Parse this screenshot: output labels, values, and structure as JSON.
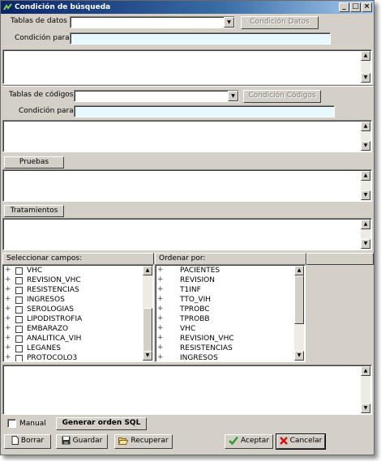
{
  "window": {
    "title": "Condición de búsqueda",
    "controls": [
      "_",
      "□",
      "×"
    ]
  },
  "datos": {
    "tables_label": "Tablas de datos",
    "condition_button": "Condición Datos",
    "condition_label": "Condición para",
    "condition_value": ""
  },
  "codigos": {
    "tables_label": "Tablas de códigos",
    "condition_button": "Condición Códigos",
    "condition_label": "Condición para",
    "condition_value": ""
  },
  "pruebas": {
    "header": "Pruebas"
  },
  "tratamientos": {
    "header": "Tratamientos"
  },
  "fields": {
    "select_header": "Seleccionar campos:",
    "order_header": "Ordenar por:",
    "select_items": [
      "VHC",
      "REVISION_VHC",
      "RESISTENCIAS",
      "INGRESOS",
      "SEROLOGIAS",
      "LIPODISTROFIA",
      "EMBARAZO",
      "ANALITICA_VIH",
      "LEGANES",
      "PROTOCOLO3"
    ],
    "order_items": [
      "PACIENTES",
      "REVISION",
      "T1INF",
      "TTO_VIH",
      "TPROBC",
      "TPROBB",
      "VHC",
      "REVISION_VHC",
      "RESISTENCIAS",
      "INGRESOS"
    ],
    "expand_glyph": "+"
  },
  "footer": {
    "manual_label": "Manual",
    "generate_sql": "Generar orden SQL",
    "borrar": "Borrar",
    "guardar": "Guardar",
    "recuperar": "Recuperar",
    "aceptar": "Aceptar",
    "cancelar": "Cancelar"
  },
  "icons": {
    "arrow_up": "▲",
    "arrow_down": "▼"
  },
  "colors": {
    "title_start": "#0a246a",
    "title_end": "#a6caf0",
    "field_bg": "#e8f8ff",
    "accept_green": "#2e9a2e",
    "cancel_red": "#d01010"
  }
}
